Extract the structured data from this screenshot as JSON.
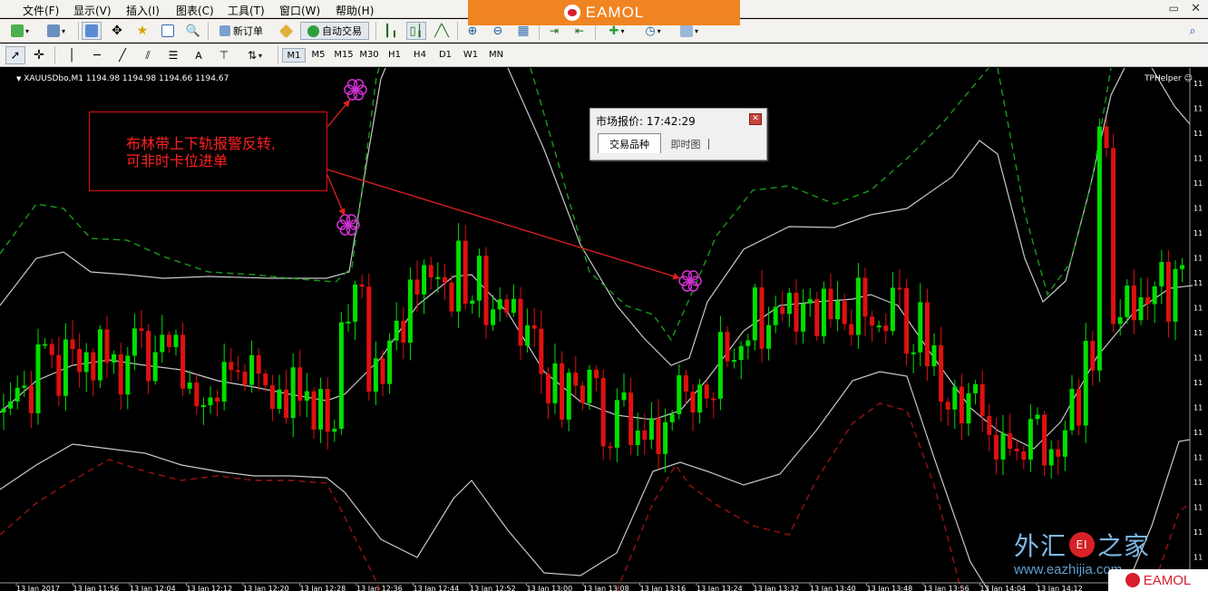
{
  "menus": [
    "文件(F)",
    "显示(V)",
    "插入(I)",
    "图表(C)",
    "工具(T)",
    "窗口(W)",
    "帮助(H)"
  ],
  "brand": {
    "text": "EAMOL",
    "color": "#f08422"
  },
  "toolbar": {
    "new_order": "新订单",
    "auto_trade": "自动交易"
  },
  "drawing_tools": {
    "text_tool": "A"
  },
  "timeframes": [
    "M1",
    "M5",
    "M15",
    "M30",
    "H1",
    "H4",
    "D1",
    "W1",
    "MN"
  ],
  "selected_timeframe": "M1",
  "chart": {
    "symbol_line": "XAUUSDbo,M1  1194.98 1194.98 1194.66 1194.67",
    "helper": "TPHelper ☺",
    "annotation": "布林带上下轨报警反转,\n可非时卡位进单",
    "time_labels": [
      "13 Jan 2017",
      "13 Jan 11:56",
      "13 Jan 12:04",
      "13 Jan 12:12",
      "13 Jan 12:20",
      "13 Jan 12:28",
      "13 Jan 12:36",
      "13 Jan 12:44",
      "13 Jan 12:52",
      "13 Jan 13:00",
      "13 Jan 13:08",
      "13 Jan 13:16",
      "13 Jan 13:24",
      "13 Jan 13:32",
      "13 Jan 13:40",
      "13 Jan 13:48",
      "13 Jan 13:56",
      "13 Jan 14:04",
      "13 Jan 14:12"
    ],
    "price_axis_label": "11",
    "colors": {
      "bull": "#00e000",
      "bear": "#e01010",
      "upper_band": "#1a9a1a",
      "lower_band": "#9a1212",
      "bands": "#c8c8c8",
      "signal": "#d030d0",
      "arrow": "#e02020"
    }
  },
  "market_watch": {
    "title": "市场报价: 17:42:29",
    "tabs": [
      "交易品种",
      "即时图"
    ]
  },
  "watermark": {
    "site": [
      "外汇",
      "EI",
      "之家"
    ],
    "url": "www.eazhijia.com",
    "corner": "EAMOL"
  }
}
